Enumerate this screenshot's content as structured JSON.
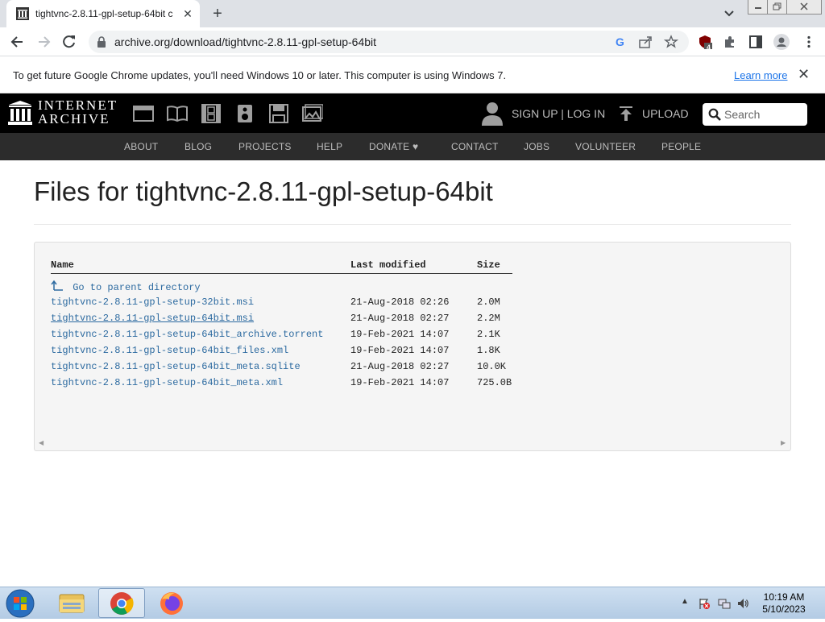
{
  "browser": {
    "tab_title": "tightvnc-2.8.11-gpl-setup-64bit c",
    "url": "archive.org/download/tightvnc-2.8.11-gpl-setup-64bit",
    "extension_badge": "4"
  },
  "infobar": {
    "message": "To get future Google Chrome updates, you'll need Windows 10 or later. This computer is using Windows 7.",
    "link": "Learn more"
  },
  "ia": {
    "wordmark_line1": "INTERNET",
    "wordmark_line2": "ARCHIVE",
    "signup": "SIGN UP | LOG IN",
    "upload": "UPLOAD",
    "search_placeholder": "Search",
    "nav": [
      "ABOUT",
      "BLOG",
      "PROJECTS",
      "HELP",
      "DONATE",
      "CONTACT",
      "JOBS",
      "VOLUNTEER",
      "PEOPLE"
    ],
    "accent_heart": "#e02020"
  },
  "page": {
    "title": "Files for tightvnc-2.8.11-gpl-setup-64bit",
    "columns": {
      "name": "Name",
      "modified": "Last modified",
      "size": "Size"
    },
    "parent_link": "Go to parent directory",
    "files": [
      {
        "name": "tightvnc-2.8.11-gpl-setup-32bit.msi",
        "modified": "21-Aug-2018 02:26",
        "size": "2.0M"
      },
      {
        "name": "tightvnc-2.8.11-gpl-setup-64bit.msi",
        "modified": "21-Aug-2018 02:27",
        "size": "2.2M"
      },
      {
        "name": "tightvnc-2.8.11-gpl-setup-64bit_archive.torrent",
        "modified": "19-Feb-2021 14:07",
        "size": "2.1K"
      },
      {
        "name": "tightvnc-2.8.11-gpl-setup-64bit_files.xml",
        "modified": "19-Feb-2021 14:07",
        "size": "1.8K"
      },
      {
        "name": "tightvnc-2.8.11-gpl-setup-64bit_meta.sqlite",
        "modified": "21-Aug-2018 02:27",
        "size": "10.0K"
      },
      {
        "name": "tightvnc-2.8.11-gpl-setup-64bit_meta.xml",
        "modified": "19-Feb-2021 14:07",
        "size": "725.0B"
      }
    ]
  },
  "taskbar": {
    "time": "10:19 AM",
    "date": "5/10/2023"
  },
  "icons": {
    "tab": "archive-favicon-icon",
    "media": [
      "web-icon",
      "texts-icon",
      "video-icon",
      "audio-icon",
      "software-icon",
      "images-icon"
    ]
  }
}
